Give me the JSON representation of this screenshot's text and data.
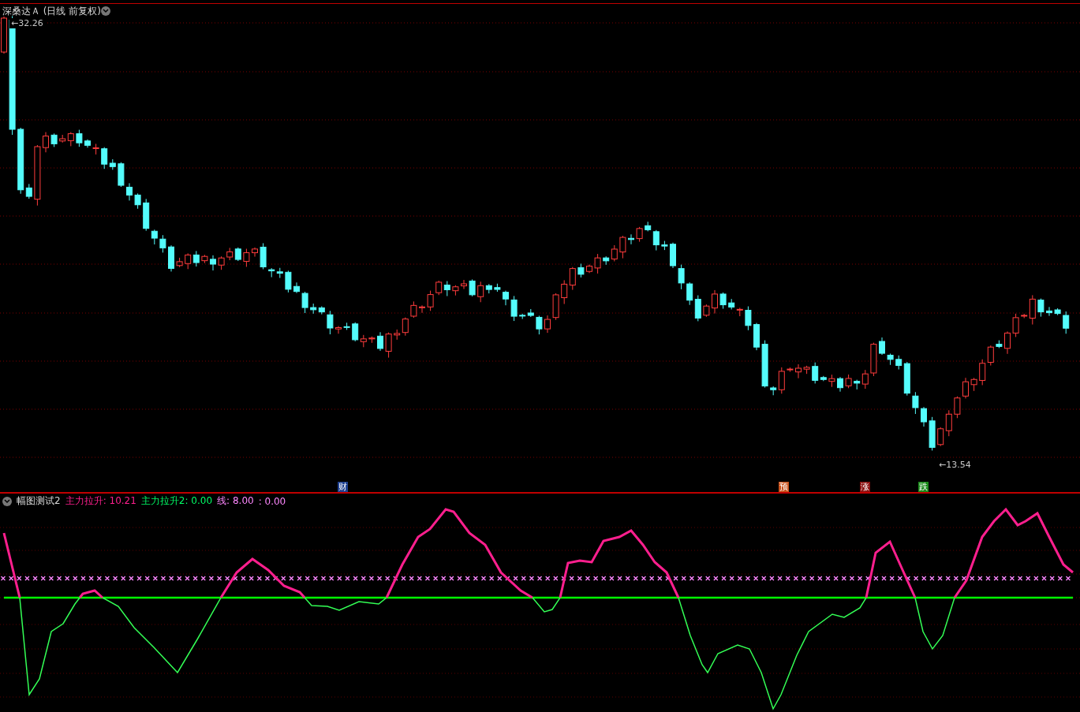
{
  "main_chart": {
    "title": "深桑达Ａ (日线 前复权)",
    "high_label": "←32.26",
    "low_label": "←13.54",
    "events": [
      {
        "text": "财",
        "color": "#1d3f8f"
      },
      {
        "text": "预",
        "color": "#c8501a"
      },
      {
        "text": "涨",
        "color": "#8a1010"
      },
      {
        "text": "跌",
        "color": "#1a8a1a"
      }
    ]
  },
  "indicator": {
    "name": "幅图测试2",
    "values": [
      {
        "text": "主力拉升: 10.21",
        "color": "#ff1f8e"
      },
      {
        "text": "主力拉升2: 0.00",
        "color": "#00ff66"
      },
      {
        "text": "线: 8.00",
        "color": "#ff88ff"
      },
      {
        "text": ": 0.00",
        "color": "#ff88ff"
      }
    ]
  }
}
